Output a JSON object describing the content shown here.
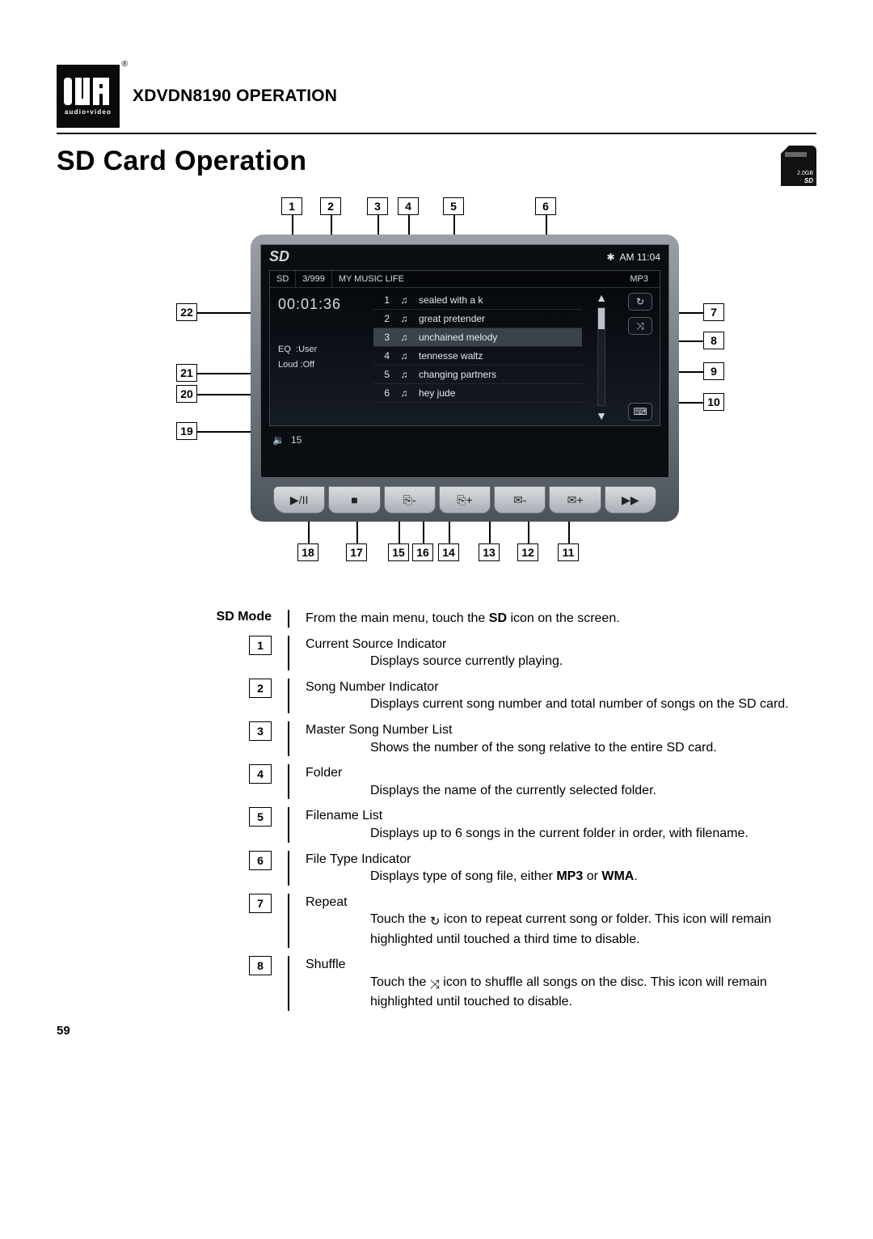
{
  "header": {
    "brand_sub": "audio•video",
    "model": "XDVDN8190",
    "model_word": "OPERATION"
  },
  "section_title": "SD Card Operation",
  "sd_card_badge": {
    "capacity": "2.0GB",
    "logo": "SD"
  },
  "diagram": {
    "topbar": {
      "bt_icon": "*",
      "clock": "AM 11:04",
      "sdicon": "SD"
    },
    "inset_head": {
      "source": "SD",
      "counter": "3/999",
      "folder": "MY MUSIC LIFE",
      "filetype": "MP3"
    },
    "elapsed": "00:01:36",
    "eq_label": "EQ",
    "eq_value": ":User",
    "loud_label": "Loud",
    "loud_value": ":Off",
    "volume_label": "15",
    "tracks": [
      {
        "n": "1",
        "title": "sealed with a k"
      },
      {
        "n": "2",
        "title": "great pretender"
      },
      {
        "n": "3",
        "title": "unchained melody"
      },
      {
        "n": "4",
        "title": "tennesse waltz"
      },
      {
        "n": "5",
        "title": "changing partners"
      },
      {
        "n": "6",
        "title": "hey jude"
      }
    ],
    "toolbar_icons": [
      "▶/II",
      "■",
      "⎘-",
      "⎘+",
      "✉-",
      "✉+",
      "▶▶"
    ],
    "callouts_top": [
      "1",
      "2",
      "3",
      "4",
      "5",
      "6"
    ],
    "callouts_right": [
      "7",
      "8",
      "9",
      "10"
    ],
    "callouts_left": [
      "22",
      "21",
      "20",
      "19"
    ],
    "callouts_bottom": [
      "18",
      "17",
      "15",
      "16",
      "14",
      "13",
      "12",
      "11"
    ]
  },
  "sd_mode_label": "SD Mode",
  "sd_mode_text_a": "From the main menu, touch the ",
  "sd_mode_text_b": "SD",
  "sd_mode_text_c": " icon on the screen.",
  "defs": [
    {
      "n": "1",
      "term": "Current Source Indicator",
      "desc": "Displays source currently playing."
    },
    {
      "n": "2",
      "term": "Song Number Indicator",
      "desc": "Displays current song number and total number of songs on the SD card."
    },
    {
      "n": "3",
      "term": "Master Song Number List",
      "desc": "Shows the number of the song relative to the entire SD card."
    },
    {
      "n": "4",
      "term": "Folder",
      "desc": "Displays the name of the currently selected folder."
    },
    {
      "n": "5",
      "term": "Filename List",
      "desc": "Displays up to 6 songs in the current folder in order, with filename."
    },
    {
      "n": "6",
      "term": "File Type Indicator",
      "desc_a": "Displays type of song file, either ",
      "desc_b": "MP3",
      "desc_c": " or ",
      "desc_d": "WMA",
      "desc_e": "."
    },
    {
      "n": "7",
      "term": "Repeat",
      "desc_a": "Touch the ",
      "icon": "↻",
      "desc_b": " icon to repeat current song or folder. This icon will remain highlighted until touched a third time to disable."
    },
    {
      "n": "8",
      "term": "Shuffle",
      "desc_a": "Touch the ",
      "icon": "⤨",
      "desc_b": " icon to shuffle all songs on the disc. This icon will remain highlighted until touched to disable."
    }
  ],
  "page_number": "59"
}
